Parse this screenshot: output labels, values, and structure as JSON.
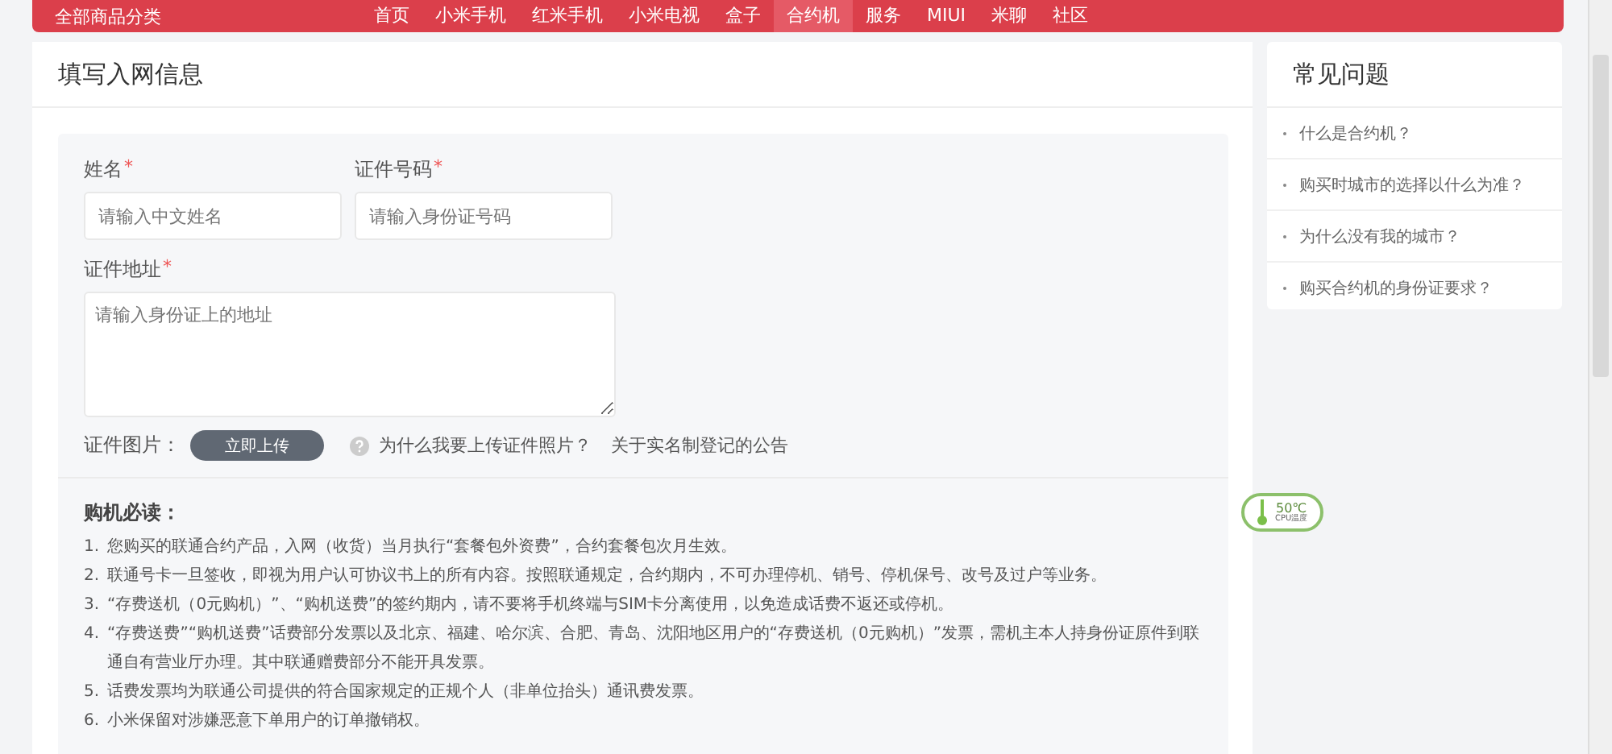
{
  "nav": {
    "category": "全部商品分类",
    "items": [
      {
        "label": "首页",
        "selected": false
      },
      {
        "label": "小米手机",
        "selected": false
      },
      {
        "label": "红米手机",
        "selected": false
      },
      {
        "label": "小米电视",
        "selected": false
      },
      {
        "label": "盒子",
        "selected": false
      },
      {
        "label": "合约机",
        "selected": true
      },
      {
        "label": "服务",
        "selected": false
      },
      {
        "label": "MIUI",
        "selected": false
      },
      {
        "label": "米聊",
        "selected": false
      },
      {
        "label": "社区",
        "selected": false
      }
    ]
  },
  "form": {
    "title": "填写入网信息",
    "fields": [
      {
        "kind": "input",
        "label": "姓名",
        "required_mark": "*",
        "placeholder": "请输入中文姓名"
      },
      {
        "kind": "input",
        "label": "证件号码",
        "required_mark": "*",
        "placeholder": "请输入身份证号码"
      },
      {
        "kind": "textarea",
        "label": "证件地址",
        "required_mark": "*",
        "placeholder": "请输入身份证上的地址"
      }
    ],
    "upload": {
      "label": "证件图片：",
      "button": "立即上传",
      "help_link": "为什么我要上传证件照片？",
      "notice_link": "关于实名制登记的公告"
    },
    "notes": {
      "title": "购机必读：",
      "items": [
        {
          "number": "1.",
          "text": "您购买的联通合约产品，入网（收货）当月执行“套餐包外资费”，合约套餐包次月生效。"
        },
        {
          "number": "2.",
          "text": "联通号卡一旦签收，即视为用户认可协议书上的所有内容。按照联通规定，合约期内，不可办理停机、销号、停机保号、改号及过户等业务。"
        },
        {
          "number": "3.",
          "text": "“存费送机（0元购机）”、“购机送费”的签约期内，请不要将手机终端与SIM卡分离使用，以免造成话费不返还或停机。"
        },
        {
          "number": "4.",
          "text": "“存费送费”“购机送费”话费部分发票以及北京、福建、哈尔滨、合肥、青岛、沈阳地区用户的“存费送机（0元购机）”发票，需机主本人持身份证原件到联通自有营业厅办理。其中联通赠费部分不能开具发票。"
        },
        {
          "number": "5.",
          "text": "话费发票均为联通公司提供的符合国家规定的正规个人（非单位抬头）通讯费发票。"
        },
        {
          "number": "6.",
          "text": "小米保留对涉嫌恶意下单用户的订单撤销权。"
        }
      ]
    }
  },
  "faq": {
    "title": "常见问题",
    "items": [
      "什么是合约机？",
      "购买时城市的选择以什么为准？",
      "为什么没有我的城市？",
      "购买合约机的身份证要求？"
    ]
  },
  "cpu_widget": {
    "temperature": "50℃",
    "label": "CPU温度"
  }
}
